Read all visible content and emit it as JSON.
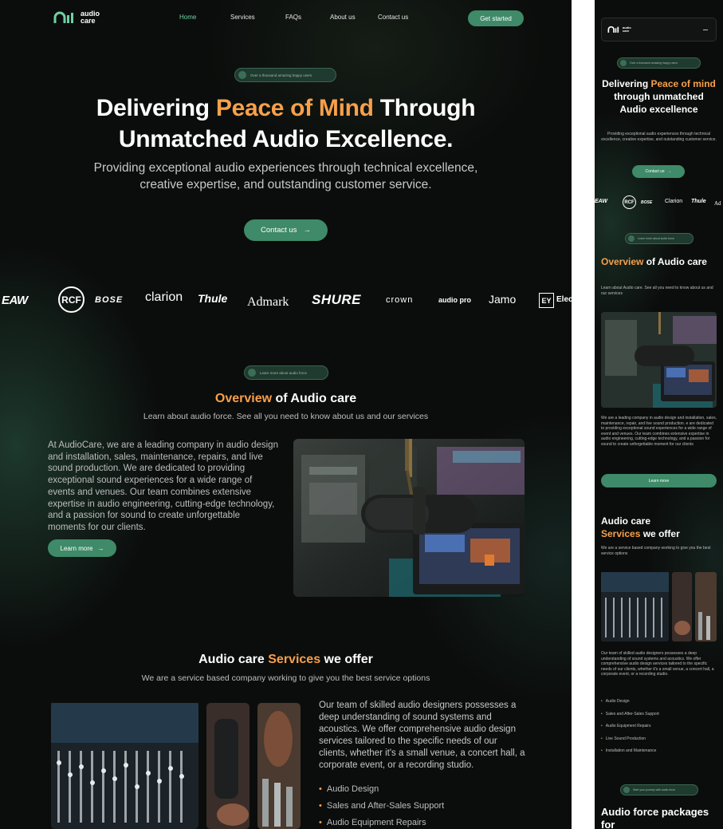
{
  "brand": {
    "name": "audio care",
    "name_line1": "audio",
    "name_line2": "care"
  },
  "nav": {
    "links": [
      "Home",
      "Services",
      "FAQs",
      "About us",
      "Contact us"
    ],
    "cta": "Get started"
  },
  "hero": {
    "pill": "Over a thousand amazing happy users",
    "title_part1": "Delivering ",
    "title_accent": "Peace of Mind",
    "title_part2": " Through",
    "title_line2": "Unmatched Audio Excellence.",
    "subtitle_line1": "Providing exceptional audio experiences through technical excellence,",
    "subtitle_line2": "creative expertise, and outstanding customer service.",
    "cta": "Contact us"
  },
  "brands": [
    "EAW",
    "RCF",
    "BOSE",
    "clarion",
    "Thule",
    "Admark",
    "SHURE",
    "crown",
    "audio pro",
    "Jamo",
    "EY",
    "Elec"
  ],
  "overview": {
    "pill": "Learn more about audio force",
    "title_accent": "Overview",
    "title_rest": " of Audio care",
    "subtitle": "Learn about audio force. See all you need to know about us and our services",
    "body": "At AudioCare, we are a leading company in audio design and installation, sales, maintenance, repairs, and live sound production. We are dedicated to providing exceptional sound experiences for a wide range of events and venues. Our team combines extensive expertise in audio engineering, cutting-edge technology, and a passion for sound to create unforgettable moments for our clients.",
    "cta": "Learn more"
  },
  "services": {
    "title_part1": "Audio care ",
    "title_accent": "Services",
    "title_part2": " we offer",
    "subtitle": "We are a service based company working to give you the best service options",
    "body": "Our team of skilled audio designers possesses a deep understanding of sound systems and acoustics. We offer comprehensive audio design services tailored to the specific needs of our clients, whether it's a small venue, a concert hall, a corporate event, or a recording studio.",
    "list": [
      "Audio Design",
      "Sales and After-Sales Support",
      "Audio Equipment Repairs"
    ]
  },
  "mobile": {
    "hero_pill": "Over a thousand amazing happy users",
    "hero_title_part1": "Delivering ",
    "hero_title_accent": "Peace of mind",
    "hero_title_part2": " through unmatched Audio excellence",
    "hero_sub": "Providing exceptional audio experiences through technical excellence, creative expertise, and outstanding customer service.",
    "hero_cta": "Contact us",
    "brands": [
      "EAW",
      "RCF",
      "BOSE",
      "Clarion",
      "Thule",
      "Ad"
    ],
    "overview_pill": "Learn more about audio force",
    "overview_title_accent": "Overview",
    "overview_title_rest": " of Audio care",
    "overview_sub": "Learn about Audio care. See all you need to know about us and our services",
    "overview_body": "We are a leading company in audio design and installation, sales, maintenance, repair, and live sound production. e are dedicated to providing exceptional sound experiences for a wide range of event and venues. Our team combines extensive expertise in audio engineering, cutting-edge technology, and a passion for sound to create unforgettable moment for our clients",
    "overview_cta": "Learn more",
    "services_title_line1": "Audio care",
    "services_title_accent": "Services",
    "services_title_rest": " we offer",
    "services_sub": "We are a service based company working to give you the best service options",
    "services_body": "Our team of skilled audio designers possesses a deep understanding of sound systems and acoustics. We offer comprehensive audio design services tailored to the specific needs of our clients, whether it's a small venue, a concert hall, a corporate event, or a recording studio.",
    "services_list": [
      "Audio Design",
      "Sales and After-Sales Support",
      "Audio Equipment Repairs",
      "Live Sound Production",
      "Installation and Maintenance"
    ],
    "packages_pill": "Start your journey with audio force",
    "packages_title": "Audio force packages for"
  },
  "colors": {
    "accent": "#f7a04b",
    "brand_green": "#3f8a68",
    "nav_active": "#6fd0a4",
    "background": "#0b0d0c"
  }
}
